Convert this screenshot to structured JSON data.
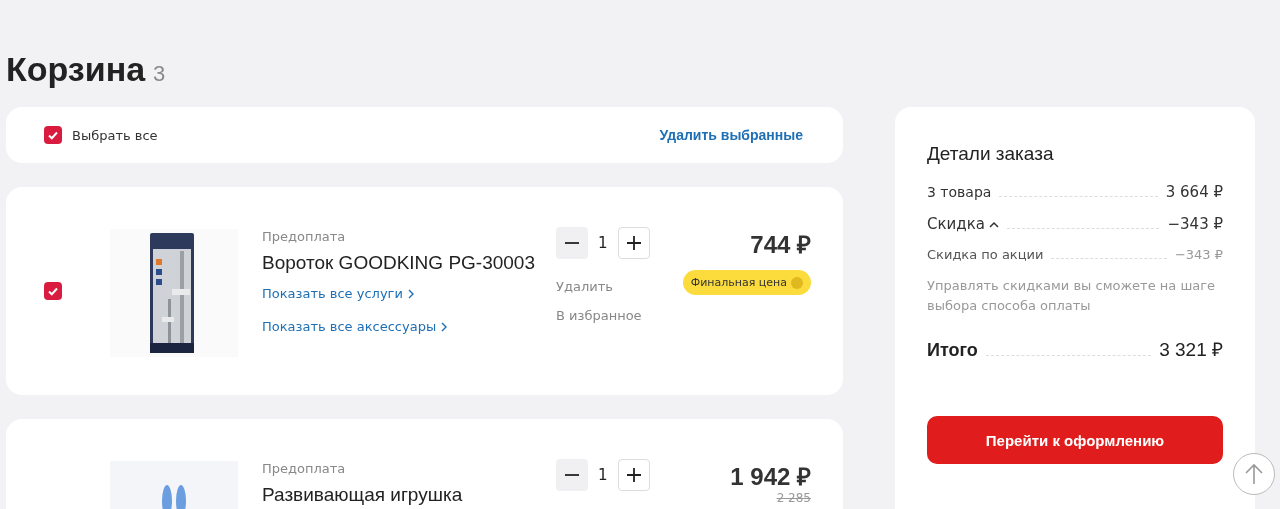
{
  "page_title": "Корзина",
  "item_count": "3",
  "select_all": {
    "label": "Выбрать все",
    "checked": true,
    "delete_selected": "Удалить выбранные"
  },
  "items": [
    {
      "checked": true,
      "payment": "Предоплата",
      "name": "Вороток GOODKING PG-30003",
      "links": [
        "Показать все услуги",
        "Показать все аксессуары"
      ],
      "quantity": "1",
      "actions": [
        "Удалить",
        "В избранное"
      ],
      "price": "744 ₽",
      "badge": "Финальная цена"
    },
    {
      "payment": "Предоплата",
      "name": "Развивающая игрушка",
      "quantity": "1",
      "price": "1 942 ₽",
      "old_price": "2 285"
    }
  ],
  "summary": {
    "title": "Детали заказа",
    "lines": [
      {
        "kind": "normal",
        "label": "3 товара",
        "value": "3 664 ₽"
      },
      {
        "kind": "toggle",
        "label": "Скидка",
        "expanded": true,
        "value": "−343 ₽"
      },
      {
        "kind": "sub",
        "label": "Скидка по акции",
        "value": "−343 ₽"
      }
    ],
    "note": "Управлять скидками вы сможете на шаге выбора способа оплаты",
    "total_label": "Итого",
    "total_value": "3 321 ₽",
    "checkout": "Перейти к оформлению"
  }
}
